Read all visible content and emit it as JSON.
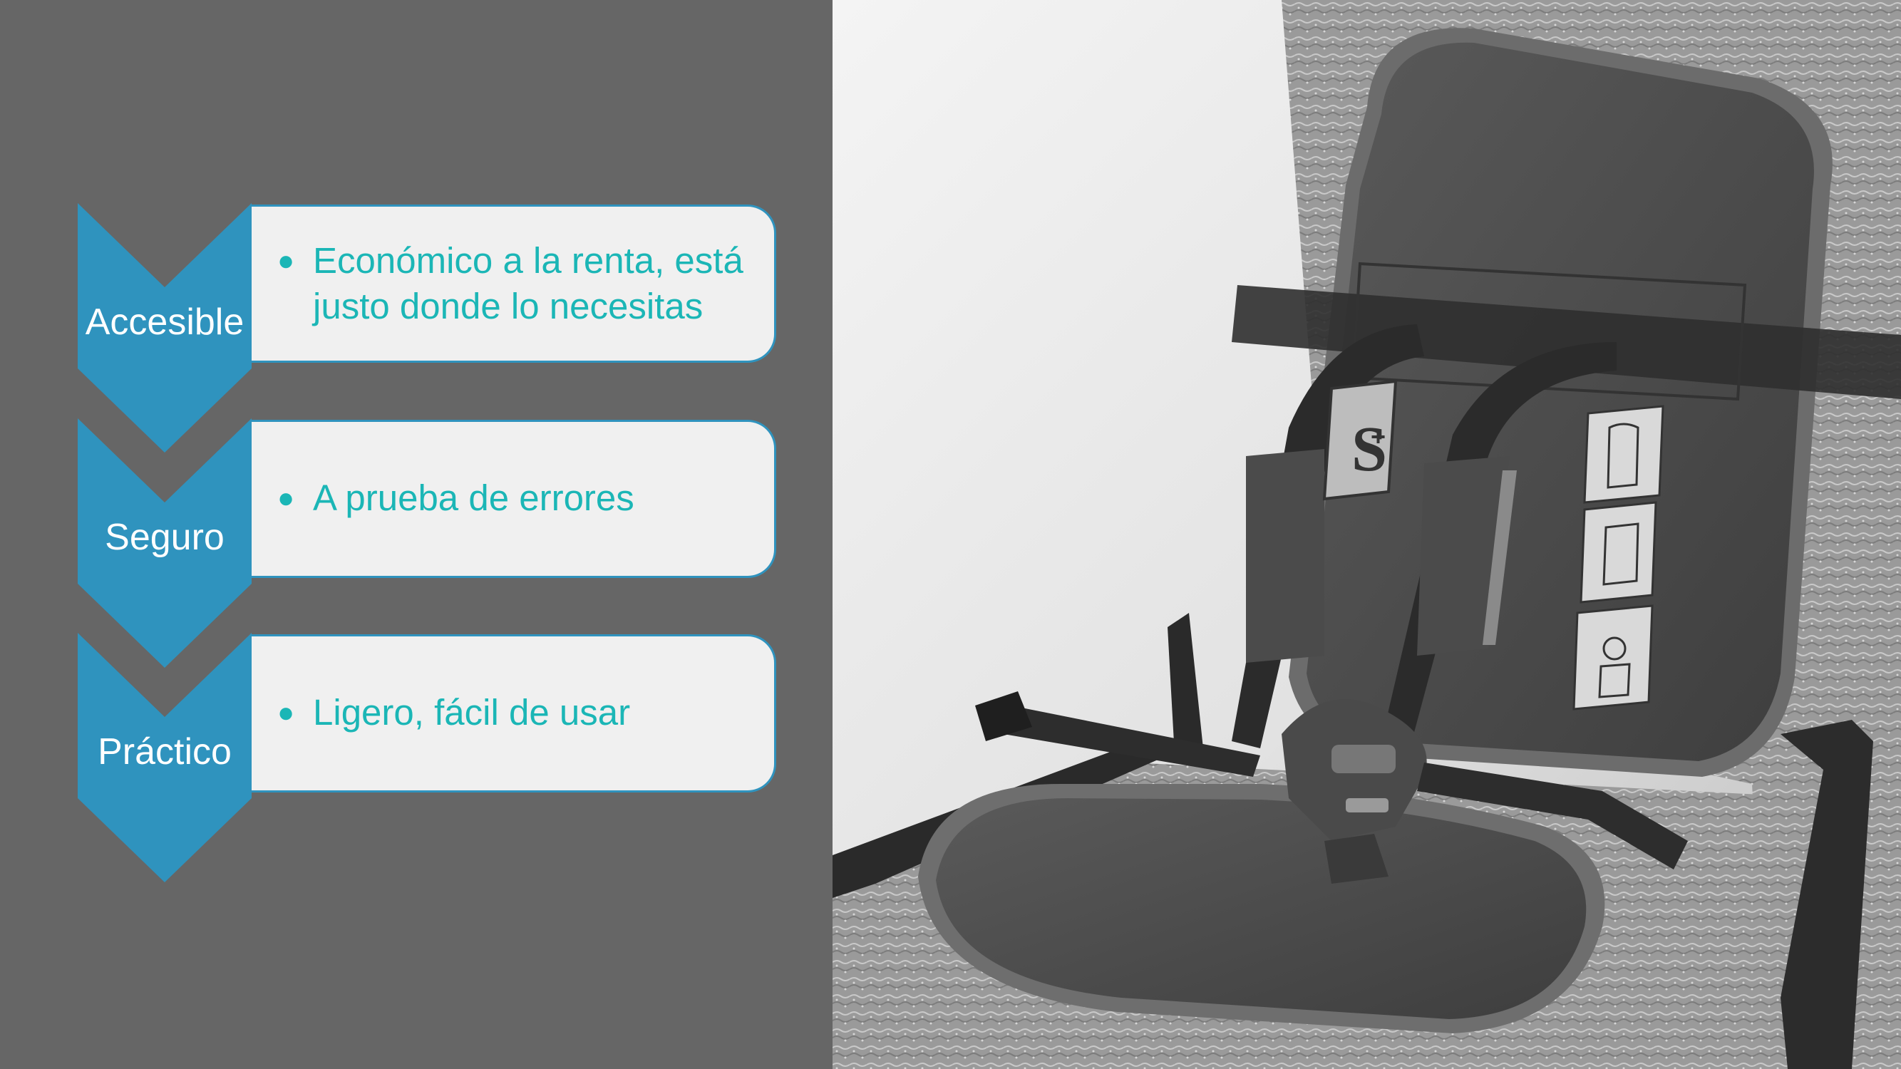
{
  "colors": {
    "background": "#666666",
    "chevron": "#2f93be",
    "card_background": "#f0f0f0",
    "bullet_text": "#1bb6b6",
    "label_text": "#ffffff"
  },
  "process": {
    "steps": [
      {
        "label": "Accesible",
        "bullet": "Económico a la renta, está justo donde lo necesitas"
      },
      {
        "label": "Seguro",
        "bullet": "A prueba de errores"
      },
      {
        "label": "Práctico",
        "bullet": "Ligero, fácil de usar"
      }
    ]
  },
  "photo": {
    "subject": "child-car-seat-photo",
    "badge_text": "S+"
  }
}
